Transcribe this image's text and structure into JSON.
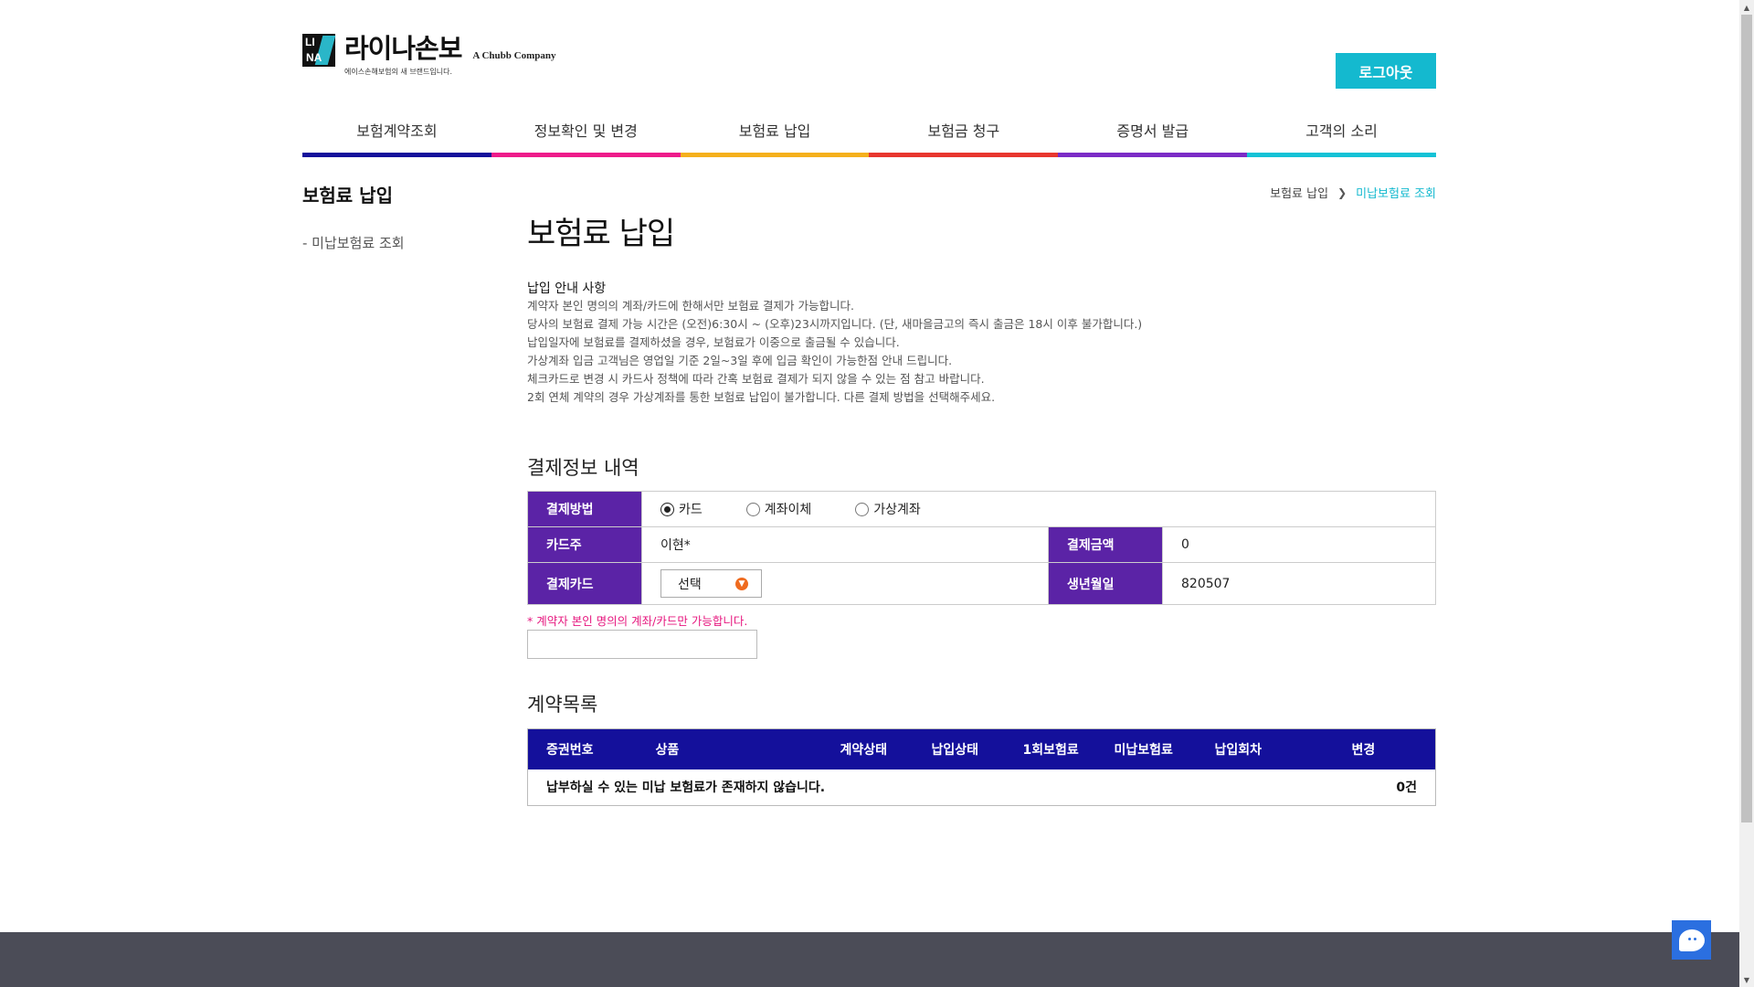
{
  "header": {
    "logo_letters_top": "LI",
    "logo_letters_bottom": "NA",
    "logo_name": "라이나손보",
    "logo_sub": "에이스손해보험의 새 브랜드입니다.",
    "logo_company": "A Chubb Company",
    "logout_label": "로그아웃"
  },
  "nav": [
    {
      "label": "보험계약조회",
      "color": "#14109b"
    },
    {
      "label": "정보확인 및 변경",
      "color": "#ee1b8a"
    },
    {
      "label": "보험료 납입",
      "color": "#f5b01c"
    },
    {
      "label": "보험금 청구",
      "color": "#e8362e"
    },
    {
      "label": "증명서 발급",
      "color": "#7b2bc6"
    },
    {
      "label": "고객의 소리",
      "color": "#14c2d6"
    }
  ],
  "sidebar": {
    "title": "보험료 납입",
    "link": "- 미납보험료 조회"
  },
  "breadcrumb": {
    "home": "보험료 납입",
    "current": "미납보험료 조회"
  },
  "main": {
    "title": "보험료 납입",
    "notice_title": "납입 안내 사항",
    "notices": [
      "계약자 본인 명의의 계좌/카드에 한해서만 보험료 결제가 가능합니다.",
      "당사의 보험료 결제 가능 시간은 (오전)6:30시 ~ (오후)23시까지입니다. (단, 새마을금고의 즉시 출금은 18시 이후 불가합니다.)",
      "납입일자에 보험료를 결제하셨을 경우, 보험료가 이중으로 출금될 수 있습니다.",
      "가상계좌 입금 고객님은 영업일 기준 2일~3일 후에 입금 확인이 가능한점 안내 드립니다.",
      "체크카드로 변경 시 카드사 정책에 따라 간혹 보험료 결제가 되지 않을 수 있는 점 참고 바랍니다.",
      "2회 연체 계약의 경우 가상계좌를 통한 보험료 납입이 불가합니다. 다른 결제 방법을 선택해주세요."
    ]
  },
  "payment": {
    "section_title": "결제정보 내역",
    "method_label": "결제방법",
    "methods": [
      "카드",
      "계좌이체",
      "가상계좌"
    ],
    "selected_method": "카드",
    "holder_label": "카드주",
    "holder_value": "이현*",
    "amount_label": "결제금액",
    "amount_value": "0",
    "card_label": "결제카드",
    "card_select": "선택",
    "birth_label": "생년월일",
    "birth_value": "820507",
    "warning": "* 계약자 본인 명의의 계좌/카드만 가능합니다."
  },
  "contracts": {
    "section_title": "계약목록",
    "columns": [
      "증권번호",
      "상품",
      "계약상태",
      "납입상태",
      "1회보험료",
      "미납보험료",
      "납입회차",
      "변경"
    ],
    "empty_message": "납부하실 수 있는 미납 보험료가 존재하지 않습니다.",
    "count": "0건"
  },
  "colors": {
    "accent": "#14b9cf",
    "purple_header": "#5b23a6",
    "navy_header": "#14109b",
    "warning": "#e6167e"
  }
}
